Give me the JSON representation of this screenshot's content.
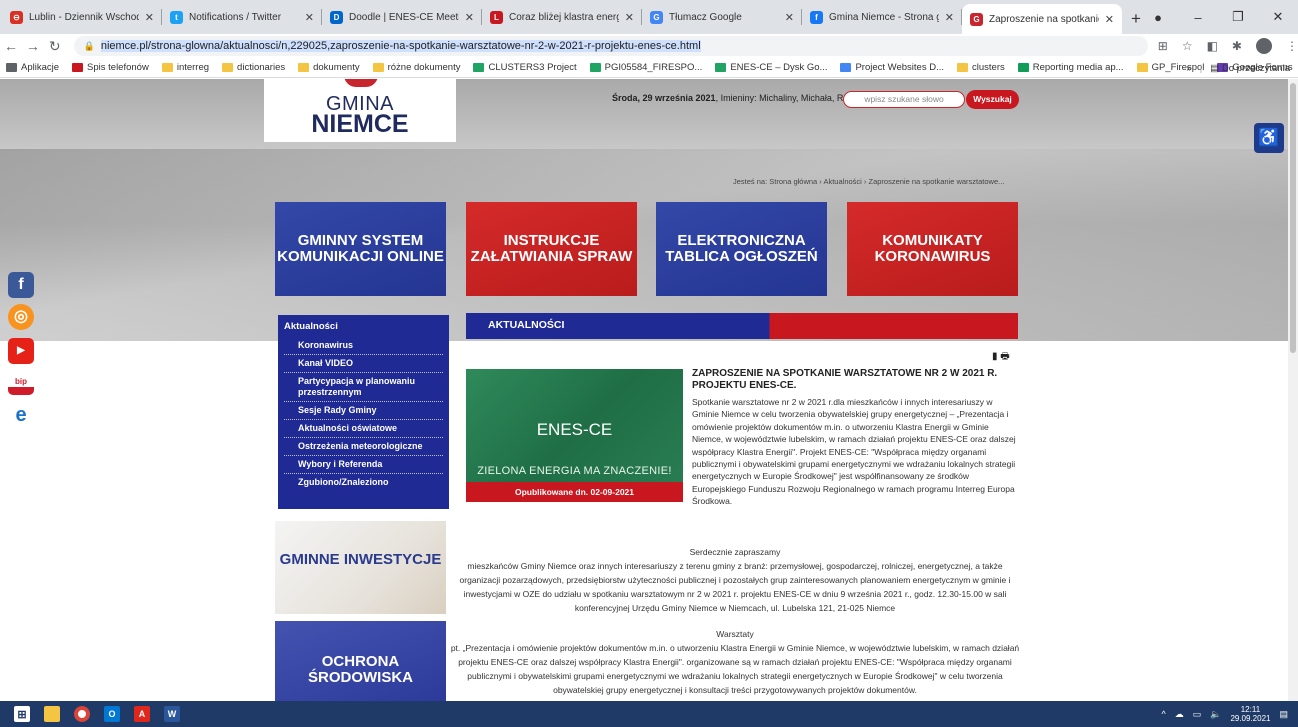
{
  "browser": {
    "tabs": [
      {
        "title": "Lublin - Dziennik Wschodni",
        "fav_color": "#d93025",
        "fav_glyph": "⊖"
      },
      {
        "title": "Notifications / Twitter",
        "fav_color": "#1da1f2",
        "fav_glyph": "t"
      },
      {
        "title": "Doodle | ENES-CE Meeting in Bu",
        "fav_color": "#0066cc",
        "fav_glyph": "D"
      },
      {
        "title": "Coraz bliżej klastra energii w Gm",
        "fav_color": "#c8171f",
        "fav_glyph": "L"
      },
      {
        "title": "Tłumacz Google",
        "fav_color": "#4285f4",
        "fav_glyph": "G"
      },
      {
        "title": "Gmina Niemce - Strona główna",
        "fav_color": "#1877f2",
        "fav_glyph": "f"
      },
      {
        "title": "Zaproszenie na spotkanie warszt",
        "fav_color": "#c8262e",
        "fav_glyph": "G"
      }
    ],
    "url": "niemce.pl/strona-glowna/aktualnosci/n,229025,zaproszenie-na-spotkanie-warsztatowe-nr-2-w-2021-r-projektu-enes-ce.html",
    "bookmarks": [
      {
        "label": "Aplikacje",
        "color": "#5f6368"
      },
      {
        "label": "Spis telefonów",
        "color": "#c8171f"
      },
      {
        "label": "interreg",
        "color": "#f4c542"
      },
      {
        "label": "dictionaries",
        "color": "#f4c542"
      },
      {
        "label": "dokumenty",
        "color": "#f4c542"
      },
      {
        "label": "różne dokumenty",
        "color": "#f4c542"
      },
      {
        "label": "CLUSTERS3 Project",
        "color": "#1fa463"
      },
      {
        "label": "PGI05584_FIRESPO...",
        "color": "#1fa463"
      },
      {
        "label": "ENES-CE – Dysk Go...",
        "color": "#1fa463"
      },
      {
        "label": "Project Websites D...",
        "color": "#4285f4"
      },
      {
        "label": "clusters",
        "color": "#f4c542"
      },
      {
        "label": "Reporting media ap...",
        "color": "#0f9d58"
      },
      {
        "label": "GP_Firespol",
        "color": "#f4c542"
      },
      {
        "label": "Google Forms",
        "color": "#673ab7"
      }
    ],
    "bookmarks_more": "»",
    "reading_list": "Do przeczytania"
  },
  "header": {
    "logo_line1": "GMINA",
    "logo_line2": "NIEMCE",
    "date_prefix": "Środa, 29 września 2021",
    "names_day": ", Imieniny: Michaliny, Michała, Rafała.",
    "search_placeholder": "wpisz szukane słowo",
    "search_button": "Wyszukaj",
    "breadcrumb": "Jesteś na: Strona główna › Aktualności › Zaproszenie na spotkanie warsztatowe..."
  },
  "tiles": [
    {
      "label": "GMINNY SYSTEM KOMUNIKACJI ONLINE"
    },
    {
      "label": "INSTRUKCJE ZAŁATWIANIA SPRAW"
    },
    {
      "label": "ELEKTRONICZNA TABLICA OGŁOSZEŃ"
    },
    {
      "label": "KOMUNIKATY KORONAWIRUS"
    }
  ],
  "social": [
    {
      "name": "facebook",
      "glyph": "f"
    },
    {
      "name": "issuu",
      "glyph": "◎"
    },
    {
      "name": "youtube",
      "glyph": "▶"
    },
    {
      "name": "bip",
      "glyph": "bip"
    },
    {
      "name": "epuap",
      "glyph": "e"
    }
  ],
  "sidebar": {
    "title": "Aktualności",
    "items": [
      "Koronawirus",
      "Kanał VIDEO",
      "Partycypacja w planowaniu przestrzennym",
      "Sesje Rady Gminy",
      "Aktualności oświatowe",
      "Ostrzeżenia meteorologiczne",
      "Wybory i Referenda",
      "Zgubiono/Znaleziono"
    ]
  },
  "news": {
    "section_title": "AKTUALNOŚCI",
    "image_title": "ENES-CE",
    "image_slogan": "ZIELONA ENERGIA MA ZNACZENIE!",
    "published": "Opublikowane dn. 02-09-2021",
    "title": "ZAPROSZENIE NA SPOTKANIE WARSZTATOWE NR 2 W 2021 R. PROJEKTU ENES-CE.",
    "body": "Spotkanie warsztatowe nr 2 w 2021 r.dla mieszkańców i innych interesariuszy w Gminie Niemce w celu tworzenia obywatelskiej grupy energetycznej – „Prezentacja i omówienie projektów dokumentów m.in. o utworzeniu Klastra Energii w Gminie Niemce, w województwie lubelskim, w ramach działań projektu ENES-CE oraz dalszej współpracy Klastra Energii\". Projekt ENES-CE: \"Współpraca między organami publicznymi i obywatelskimi grupami energetycznymi we wdrażaniu lokalnych strategii energetycznych w Europie Środkowej\" jest współfinansowany ze środków Europejskiego Funduszu Rozwoju Regionalnego w ramach programu Interreg Europa Środkowa.",
    "para1_head": "Serdecznie zapraszamy",
    "para1": "mieszkańców Gminy Niemce oraz innych interesariuszy z terenu gminy z branż: przemysłowej, gospodarczej, rolniczej, energetycznej, a także organizacji pozarządowych, przedsiębiorstw użyteczności publicznej i pozostałych grup  zainteresowanych planowaniem energetycznym w gminie i inwestycjami w OZE do udziału w spotkaniu warsztatowym nr 2 w 2021 r. projektu ENES-CE w dniu 9 września 2021 r., godz. 12.30-15.00 w sali konferencyjnej Urzędu Gminy Niemce w Niemcach, ul. Lubelska 121, 21-025 Niemce",
    "para2_head": "Warsztaty",
    "para2": "pt. „Prezentacja i omówienie projektów dokumentów m.in. o utworzeniu Klastra Energii w Gminie Niemce, w województwie lubelskim, w ramach działań projektu ENES-CE oraz dalszej współpracy Klastra Energii\". organizowane są w ramach działań projektu ENES-CE: \"Współpraca między organami publicznymi i obywatelskimi grupami energetycznymi we wdrażaniu lokalnych strategii energetycznych w Europie Środkowej\" w celu tworzenia obywatelskiej grupy energetycznej i konsultacji treści przygotowywanych projektów dokumentów."
  },
  "promo": {
    "invest": "GMINNE INWESTYCJE",
    "ochrona": "OCHRONA ŚRODOWISKA"
  },
  "taskbar": {
    "time": "12:11",
    "date": "29.09.2021"
  }
}
